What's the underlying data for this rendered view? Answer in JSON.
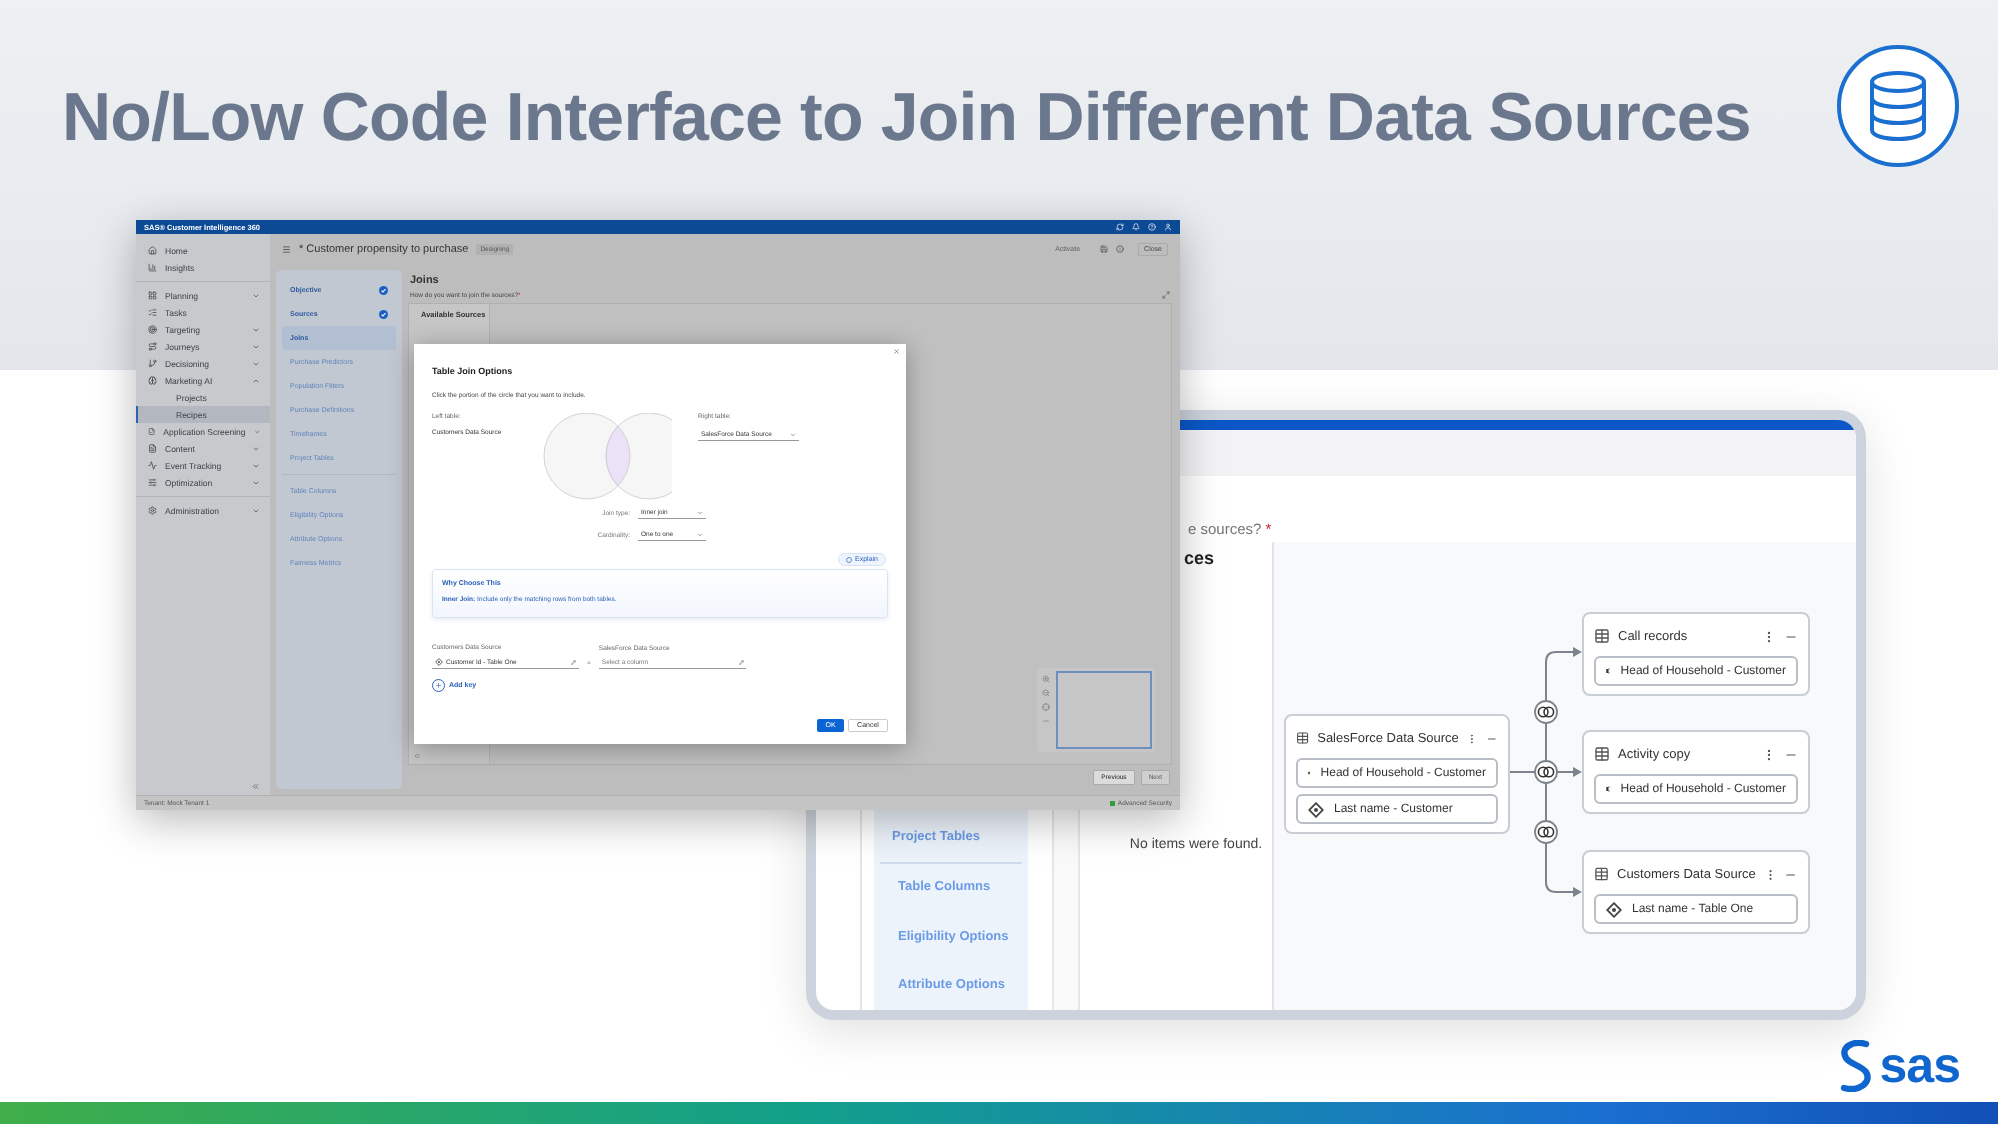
{
  "slide": {
    "title": "No/Low Code Interface to Join Different Data Sources",
    "logo_text": "sas"
  },
  "small_app": {
    "product": "SAS® Customer Intelligence 360",
    "nav_sections": [
      [
        {
          "label": "Home",
          "kind": "link",
          "selected": false
        },
        {
          "label": "Insights",
          "kind": "link",
          "selected": false
        }
      ],
      [
        {
          "label": "Planning",
          "kind": "group",
          "expanded": false,
          "selected": false
        },
        {
          "label": "Tasks",
          "kind": "link",
          "selected": false
        },
        {
          "label": "Targeting",
          "kind": "group",
          "expanded": false,
          "selected": false
        },
        {
          "label": "Journeys",
          "kind": "group",
          "expanded": false,
          "selected": false
        },
        {
          "label": "Decisioning",
          "kind": "group",
          "expanded": false,
          "selected": false
        },
        {
          "label": "Marketing AI",
          "kind": "group",
          "expanded": true,
          "selected": false,
          "children": [
            {
              "label": "Projects",
              "selected": false
            },
            {
              "label": "Recipes",
              "selected": true
            }
          ]
        },
        {
          "label": "Application Screening",
          "kind": "group",
          "expanded": false,
          "selected": false
        },
        {
          "label": "Content",
          "kind": "group",
          "expanded": false,
          "selected": false
        },
        {
          "label": "Event Tracking",
          "kind": "group",
          "expanded": false,
          "selected": false
        },
        {
          "label": "Optimization",
          "kind": "group",
          "expanded": false,
          "selected": false
        }
      ],
      [
        {
          "label": "Administration",
          "kind": "group",
          "expanded": false,
          "selected": false
        }
      ]
    ],
    "tenant": "Tenant: Mock Tenant 1",
    "project_title": "* Customer propensity to purchase",
    "status": "Designing",
    "activate": {
      "label": "Activate",
      "disabled": true
    },
    "close": "Close",
    "steps": [
      [
        {
          "label": "Objective",
          "done": true,
          "selected": false
        },
        {
          "label": "Sources",
          "done": true,
          "selected": false
        },
        {
          "label": "Joins",
          "done": false,
          "selected": true
        },
        {
          "label": "Purchase Predictors",
          "done": false,
          "selected": false
        },
        {
          "label": "Population Filters",
          "done": false,
          "selected": false
        },
        {
          "label": "Purchase Definitions",
          "done": false,
          "selected": false
        },
        {
          "label": "Timeframes",
          "done": false,
          "selected": false
        },
        {
          "label": "Project Tables",
          "done": false,
          "selected": false
        }
      ],
      [
        {
          "label": "Table Columns",
          "done": false,
          "selected": false
        },
        {
          "label": "Eligibility Options",
          "done": false,
          "selected": false
        },
        {
          "label": "Attribute Options",
          "done": false,
          "selected": false
        },
        {
          "label": "Fairness Metrics",
          "done": false,
          "selected": false
        }
      ]
    ],
    "section_title": "Joins",
    "question": "How do you want to join the sources?",
    "required_mark": "*",
    "panel_title": "Available Sources",
    "previous": "Previous",
    "next": {
      "label": "Next",
      "disabled": true
    },
    "security": "Advanced Security"
  },
  "dialog": {
    "title": "Table Join Options",
    "instruction": "Click the portion of the circle that you want to include.",
    "left_label": "Left table:",
    "left_value": "Customers Data Source",
    "right_label": "Right table:",
    "right_value": "SalesForce Data Source",
    "venn": {
      "left": false,
      "intersection": true,
      "right": false
    },
    "join_type_label": "Join type:",
    "join_type": "Inner join",
    "cardinality_label": "Cardinality:",
    "cardinality": "One to one",
    "explain": "Explain",
    "why_title": "Why Choose This",
    "why_text": "**Inner Join:** Include only the matching rows from both tables.",
    "key_left_label": "Customers Data Source",
    "key_left_value": "Customer Id - Table One",
    "equals": "=",
    "key_right_label": "SalesForce Data Source",
    "key_right_placeholder": "Select a column",
    "add_key": "Add key",
    "ok": "OK",
    "cancel": "Cancel"
  },
  "large_app": {
    "question_tail": "e sources?",
    "required_mark": "*",
    "panel_title_tail": "ces",
    "steps": [
      [
        "Project Tables"
      ],
      [
        "Table Columns",
        "Eligibility Options",
        "Attribute Options"
      ]
    ],
    "empty_message": "No items were found.",
    "source": {
      "title": "SalesForce Data Source",
      "fields": [
        {
          "kind": "column",
          "label": "Head of Household - Customer"
        },
        {
          "kind": "tag",
          "label": "Last name - Customer"
        }
      ]
    },
    "targets": [
      {
        "title": "Call records",
        "fields": [
          {
            "kind": "column",
            "label": "Head of Household - Customer"
          }
        ]
      },
      {
        "title": "Activity copy",
        "fields": [
          {
            "kind": "column",
            "label": "Head of Household - Customer"
          }
        ]
      },
      {
        "title": "Customers Data Source",
        "fields": [
          {
            "kind": "tag",
            "label": "Last name - Table One"
          }
        ]
      }
    ]
  }
}
